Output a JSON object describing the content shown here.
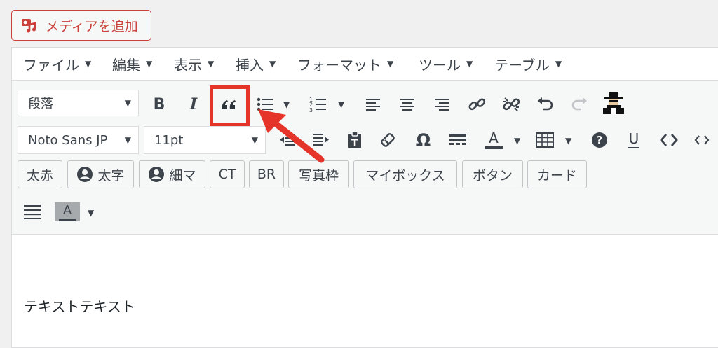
{
  "media": {
    "label": "メディアを追加"
  },
  "menubar": [
    {
      "label": "ファイル"
    },
    {
      "label": "編集"
    },
    {
      "label": "表示"
    },
    {
      "label": "挿入"
    },
    {
      "label": "フォーマット"
    },
    {
      "label": "ツール"
    },
    {
      "label": "テーブル"
    }
  ],
  "toolbar1": {
    "format_select": "段落",
    "bold": "B",
    "italic": "I",
    "blockquote": "“"
  },
  "toolbar2": {
    "font_family": "Noto Sans JP",
    "font_size": "11pt",
    "omega": "Ω",
    "text_color_letter": "A",
    "underline": "U"
  },
  "toolbar3": [
    {
      "label": "太赤",
      "icon": ""
    },
    {
      "label": "太字",
      "icon": "user-circle-icon"
    },
    {
      "label": "細マ",
      "icon": "user-circle-icon"
    },
    {
      "label": "CT",
      "icon": ""
    },
    {
      "label": "BR",
      "icon": ""
    },
    {
      "label": "写真枠",
      "icon": ""
    },
    {
      "label": "マイボックス",
      "icon": ""
    },
    {
      "label": "ボタン",
      "icon": ""
    },
    {
      "label": "カード",
      "icon": ""
    }
  ],
  "toolbar4": {
    "bg_color_letter": "A"
  },
  "content": {
    "text": "テキストテキスト"
  },
  "colors": {
    "accent": "#c9413a",
    "highlight": "#e5352a"
  }
}
